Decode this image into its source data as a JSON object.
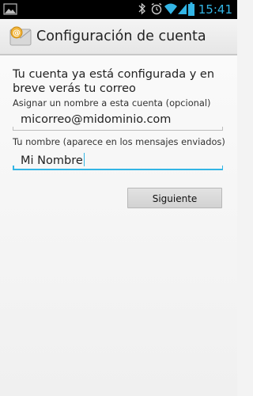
{
  "status_bar": {
    "time": "15:41",
    "icons": [
      "gallery-notification-icon",
      "bluetooth-icon",
      "alarm-icon",
      "wifi-icon",
      "cell-signal-icon",
      "battery-icon"
    ],
    "accent_color": "#33b5e5"
  },
  "action_bar": {
    "app_icon": "email-envelope-icon",
    "title": "Configuración de cuenta"
  },
  "form": {
    "intro": "Tu cuenta ya está configurada y en breve verás tu correo",
    "account_name_label": "Asignar un nombre a esta cuenta (opcional)",
    "account_name_value": "micorreo@midominio.com",
    "your_name_label": "Tu nombre (aparece en los mensajes enviados)",
    "your_name_value": "Mi Nombre",
    "next_button": "Siguiente"
  }
}
